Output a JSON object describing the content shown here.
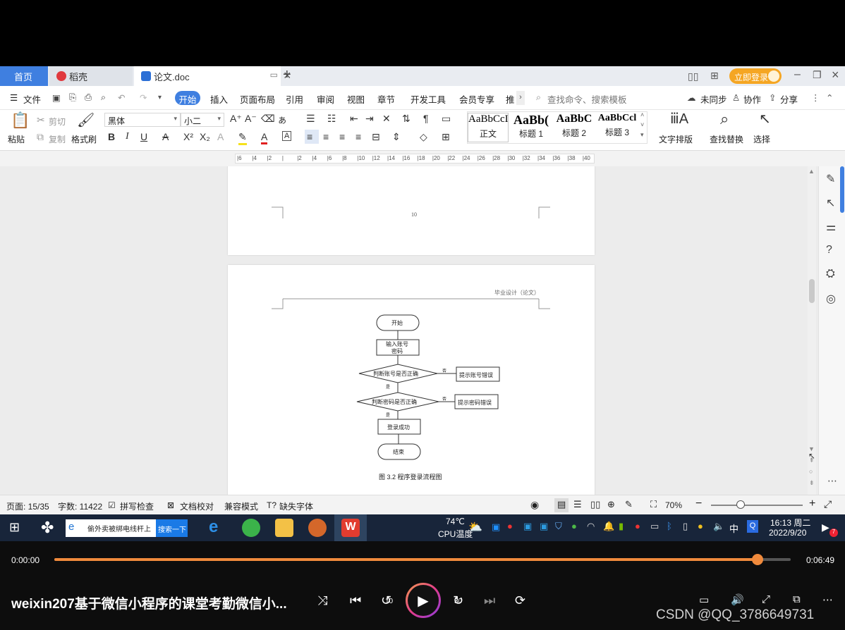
{
  "tabs": {
    "home": "首页",
    "daoke": "稻壳",
    "doc": "论文.doc",
    "login": "立即登录"
  },
  "menu": {
    "file": "文件",
    "items": [
      "开始",
      "插入",
      "页面布局",
      "引用",
      "审阅",
      "视图",
      "章节",
      "开发工具",
      "会员专享",
      "推"
    ],
    "search_placeholder": "查找命令、搜索模板",
    "sync": "未同步",
    "collab": "协作",
    "share": "分享"
  },
  "ribbon": {
    "paste": "粘贴",
    "cut": "剪切",
    "copy": "复制",
    "format_painter": "格式刷",
    "font_name": "黑体",
    "font_size": "小二",
    "styles": [
      {
        "preview": "AaBbCcI",
        "label": "正文"
      },
      {
        "preview": "AaBb(",
        "label": "标题 1"
      },
      {
        "preview": "AaBbC",
        "label": "标题 2"
      },
      {
        "preview": "AaBbCcl",
        "label": "标题 3"
      }
    ],
    "text_layout": "文字排版",
    "find_replace": "查找替换",
    "select": "选择"
  },
  "ruler_ticks": [
    "6",
    "4",
    "2",
    "",
    "2",
    "4",
    "6",
    "8",
    "10",
    "12",
    "14",
    "16",
    "18",
    "20",
    "22",
    "24",
    "26",
    "28",
    "30",
    "32",
    "34",
    "36",
    "38",
    "40"
  ],
  "document": {
    "page1_number": "10",
    "header_text": "毕业设计（论文）",
    "flow": {
      "start": "开始",
      "input_line1": "输入账号",
      "input_line2": "密码",
      "check_account": "判断账号是否正确",
      "account_error": "提示账号错误",
      "check_password": "判断密码是否正确",
      "password_error": "提示密码错误",
      "success": "登录成功",
      "end": "结束",
      "yes": "是",
      "no": "否"
    },
    "caption": "图 3.2  程序登录流程图"
  },
  "status": {
    "page": "页面: 15/35",
    "words": "字数: 11422",
    "spell": "拼写检查",
    "proof": "文档校对",
    "compat": "兼容模式",
    "missing_font": "缺失字体",
    "zoom": "70%"
  },
  "taskbar": {
    "search_text": "偷外卖被绑电线杆上",
    "search_button": "搜索一下",
    "temp": "74℃",
    "temp_label": "CPU温度",
    "ime": "中",
    "time": "16:13 周二",
    "date": "2022/9/20",
    "notif_count": "7"
  },
  "player": {
    "current_time": "0:00:00",
    "total_time": "0:06:49",
    "progress": 0.955,
    "title": "weixin207基于微信小程序的课堂考勤微信小...",
    "rewind_label": "10",
    "forward_label": "30",
    "watermark": "CSDN @QQ_3786649731"
  }
}
